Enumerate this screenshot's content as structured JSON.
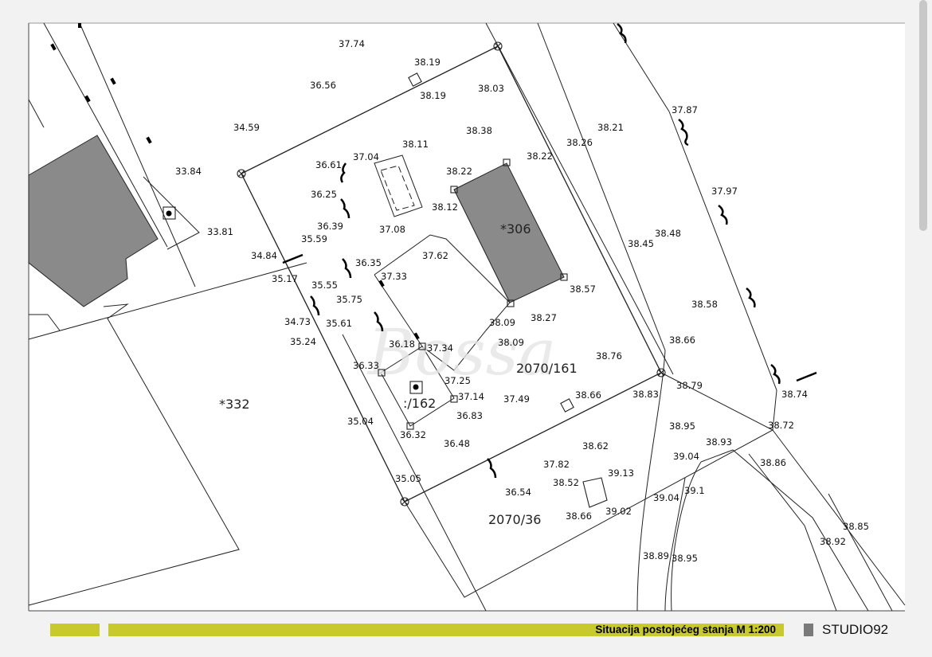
{
  "drawing": {
    "parcels": [
      "*332",
      "*306",
      "2070/161",
      ":/162",
      "2070/36"
    ],
    "elevations": [
      "37.74",
      "38.19",
      "38.19",
      "36.56",
      "38.03",
      "34.59",
      "38.38",
      "38.11",
      "37.04",
      "36.61",
      "38.21",
      "38.26",
      "37.87",
      "38.22",
      "38.22",
      "36.25",
      "33.84",
      "38.12",
      "33.81",
      "36.39",
      "37.08",
      "35.59",
      "37.97",
      "37.62",
      "34.84",
      "36.35",
      "38.48",
      "38.45",
      "35.17",
      "37.33",
      "35.55",
      "38.57",
      "35.75",
      "38.58",
      "34.73",
      "35.61",
      "38.09",
      "38.27",
      "35.24",
      "38.09",
      "36.18",
      "37.34",
      "38.66",
      "38.76",
      "36.33",
      "37.25",
      "38.79",
      "37.14",
      "37.49",
      "38.66",
      "38.83",
      "36.83",
      "38.74",
      "35.04",
      "38.72",
      "36.32",
      "38.95",
      "36.48",
      "38.62",
      "38.93",
      "39.04",
      "38.86",
      "37.82",
      "39.13",
      "35.05",
      "38.52",
      "39.1",
      "36.54",
      "39.04",
      "39.02",
      "38.66",
      "38.85",
      "38.92",
      "38.89",
      "38.95"
    ]
  },
  "footer": {
    "caption": "Situacija postojećeg stanja M 1:200",
    "studio": "STUDIO92"
  },
  "colors": {
    "accent": "#c8c92d",
    "building": "#8a8a8a",
    "studio_mark": "#7a7a7a"
  }
}
